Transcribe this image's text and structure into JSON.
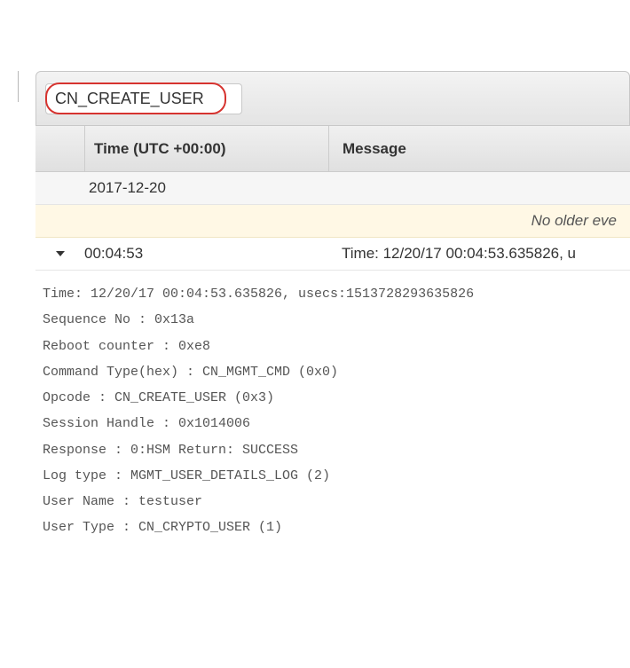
{
  "search": {
    "value": "CN_CREATE_USER"
  },
  "table": {
    "headers": {
      "time": "Time (UTC +00:00)",
      "message": "Message"
    },
    "date_group": "2017-12-20",
    "older_notice": "No older eve",
    "row": {
      "time": "00:04:53",
      "message": "Time: 12/20/17 00:04:53.635826, u"
    }
  },
  "details": {
    "lines": [
      "Time: 12/20/17 00:04:53.635826, usecs:1513728293635826",
      "Sequence No : 0x13a",
      "Reboot counter : 0xe8",
      "Command Type(hex) : CN_MGMT_CMD (0x0)",
      "Opcode : CN_CREATE_USER (0x3)",
      "Session Handle : 0x1014006",
      "Response : 0:HSM Return: SUCCESS",
      "Log type : MGMT_USER_DETAILS_LOG (2)",
      "User Name : testuser",
      "User Type : CN_CRYPTO_USER (1)"
    ]
  }
}
